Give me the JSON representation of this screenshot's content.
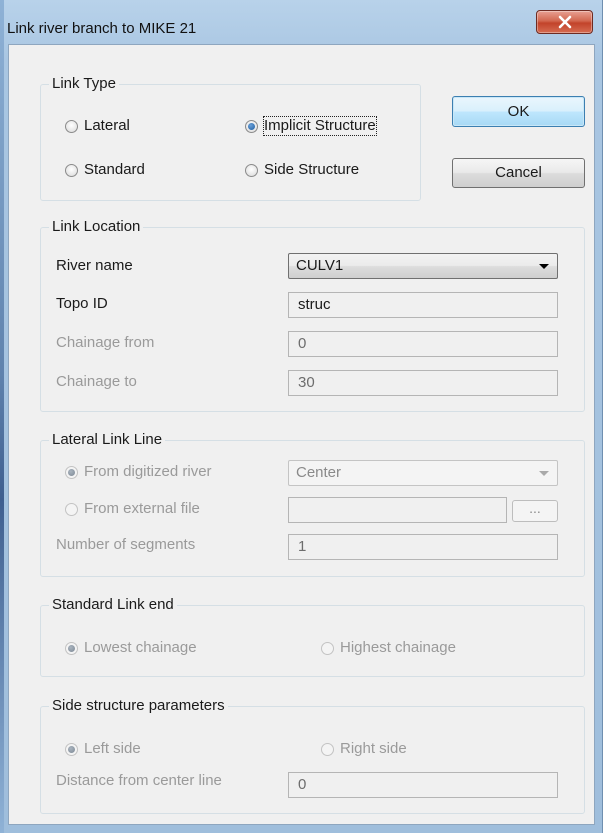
{
  "window": {
    "title": "Link river branch to MIKE 21",
    "close_symbol": "X"
  },
  "link_type": {
    "legend": "Link Type",
    "lateral": "Lateral",
    "implicit_structure": "Implicit Structure",
    "standard": "Standard",
    "side_structure": "Side Structure",
    "selected": "implicit_structure"
  },
  "buttons": {
    "ok": "OK",
    "cancel": "Cancel",
    "browse": "..."
  },
  "link_location": {
    "legend": "Link Location",
    "river_name_label": "River name",
    "river_name_value": "CULV1",
    "topo_id_label": "Topo ID",
    "topo_id_value": "struc",
    "chainage_from_label": "Chainage from",
    "chainage_from_value": "0",
    "chainage_to_label": "Chainage to",
    "chainage_to_value": "30"
  },
  "lateral_link_line": {
    "legend": "Lateral Link Line",
    "from_digitized": "From digitized river",
    "from_external": "From external file",
    "segments_label": "Number of segments",
    "position_value": "Center",
    "external_file_value": "",
    "segments_value": "1"
  },
  "standard_link_end": {
    "legend": "Standard Link end",
    "lowest": "Lowest chainage",
    "highest": "Highest chainage"
  },
  "side_structure": {
    "legend": "Side structure parameters",
    "left": "Left side",
    "right": "Right side",
    "distance_label": "Distance from center line",
    "distance_value": "0"
  }
}
